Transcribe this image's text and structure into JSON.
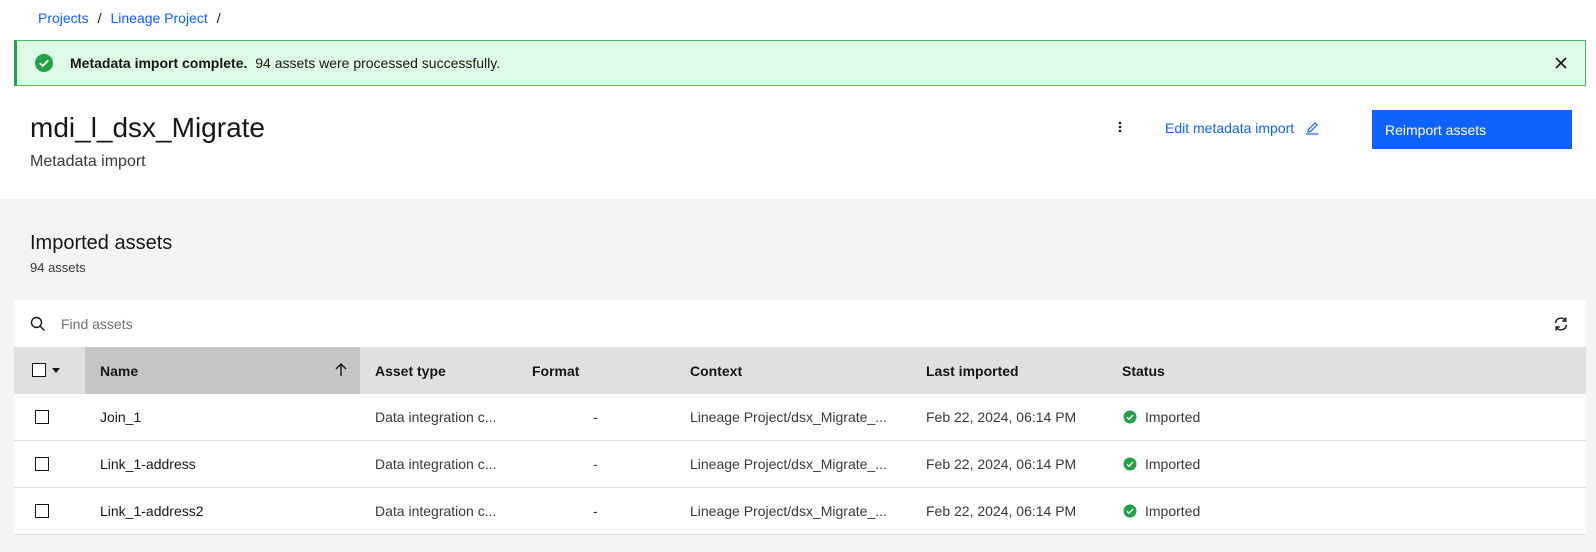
{
  "breadcrumb": {
    "items": [
      "Projects",
      "Lineage Project"
    ],
    "separator": "/"
  },
  "notification": {
    "title": "Metadata import complete.",
    "message": "94 assets were processed successfully.",
    "icon": "checkmark-filled-icon",
    "colors": {
      "bg": "#defbe6",
      "border": "#24a148"
    }
  },
  "header": {
    "title": "mdi_l_dsx_Migrate",
    "subtitle": "Metadata import",
    "edit_label": "Edit metadata import",
    "primary_button": "Reimport assets",
    "accent": "#0f62fe"
  },
  "assets": {
    "title": "Imported assets",
    "count": "94 assets",
    "search_placeholder": "Find assets",
    "columns": [
      "Name",
      "Asset type",
      "Format",
      "Context",
      "Last imported",
      "Status"
    ],
    "sort": {
      "column": "Name",
      "direction": "ascending"
    },
    "rows": [
      {
        "name": "Join_1",
        "asset_type": "Data integration c...",
        "format": "-",
        "context": "Lineage Project/dsx_Migrate_...",
        "last_imported": "Feb 22, 2024, 06:14 PM",
        "status": "Imported"
      },
      {
        "name": "Link_1-address",
        "asset_type": "Data integration c...",
        "format": "-",
        "context": "Lineage Project/dsx_Migrate_...",
        "last_imported": "Feb 22, 2024, 06:14 PM",
        "status": "Imported"
      },
      {
        "name": "Link_1-address2",
        "asset_type": "Data integration c...",
        "format": "-",
        "context": "Lineage Project/dsx_Migrate_...",
        "last_imported": "Feb 22, 2024, 06:14 PM",
        "status": "Imported"
      }
    ]
  }
}
